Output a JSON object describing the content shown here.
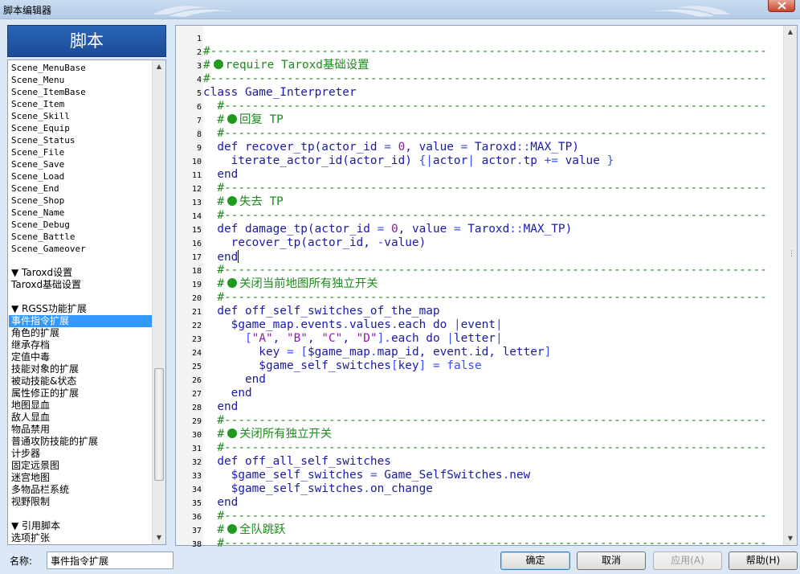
{
  "window": {
    "title": "脚本编辑器"
  },
  "left_panel": {
    "header": "脚本",
    "items": [
      {
        "label": "Scene_MenuBase",
        "mono": true
      },
      {
        "label": "Scene_Menu",
        "mono": true
      },
      {
        "label": "Scene_ItemBase",
        "mono": true
      },
      {
        "label": "Scene_Item",
        "mono": true
      },
      {
        "label": "Scene_Skill",
        "mono": true
      },
      {
        "label": "Scene_Equip",
        "mono": true
      },
      {
        "label": "Scene_Status",
        "mono": true
      },
      {
        "label": "Scene_File",
        "mono": true
      },
      {
        "label": "Scene_Save",
        "mono": true
      },
      {
        "label": "Scene_Load",
        "mono": true
      },
      {
        "label": "Scene_End",
        "mono": true
      },
      {
        "label": "Scene_Shop",
        "mono": true
      },
      {
        "label": "Scene_Name",
        "mono": true
      },
      {
        "label": "Scene_Debug",
        "mono": true
      },
      {
        "label": "Scene_Battle",
        "mono": true
      },
      {
        "label": "Scene_Gameover",
        "mono": true
      },
      {
        "label": ""
      },
      {
        "label": "▼ Taroxd设置"
      },
      {
        "label": "Taroxd基础设置"
      },
      {
        "label": ""
      },
      {
        "label": "▼ RGSS功能扩展"
      },
      {
        "label": "事件指令扩展",
        "selected": true
      },
      {
        "label": "角色的扩展"
      },
      {
        "label": "继承存档"
      },
      {
        "label": "定值中毒"
      },
      {
        "label": "技能对象的扩展"
      },
      {
        "label": "被动技能&状态"
      },
      {
        "label": "属性修正的扩展"
      },
      {
        "label": "地图显血"
      },
      {
        "label": "敌人显血"
      },
      {
        "label": "物品禁用"
      },
      {
        "label": "普通攻防技能的扩展"
      },
      {
        "label": "计步器"
      },
      {
        "label": "固定远景图"
      },
      {
        "label": "迷宫地图"
      },
      {
        "label": "多物品栏系统"
      },
      {
        "label": "视野限制"
      },
      {
        "label": ""
      },
      {
        "label": "▼ 引用脚本"
      },
      {
        "label": "选项扩张"
      }
    ]
  },
  "editor": {
    "lines": [
      {
        "n": "1",
        "parts": []
      },
      {
        "n": "2",
        "parts": [
          {
            "c": "c",
            "t": "#--------------------------------------------------------------------------------"
          }
        ]
      },
      {
        "n": "3",
        "parts": [
          {
            "c": "c",
            "t": "#"
          },
          {
            "c": "bullet"
          },
          {
            "c": "c",
            "t": "require Taroxd基础设置"
          }
        ]
      },
      {
        "n": "4",
        "parts": [
          {
            "c": "c",
            "t": "#--------------------------------------------------------------------------------"
          }
        ]
      },
      {
        "n": "5",
        "parts": [
          {
            "t": "class Game_Interpreter"
          }
        ]
      },
      {
        "n": "6",
        "parts": [
          {
            "c": "c",
            "t": "  #------------------------------------------------------------------------------"
          }
        ]
      },
      {
        "n": "7",
        "parts": [
          {
            "c": "c",
            "t": "  #"
          },
          {
            "c": "bullet"
          },
          {
            "c": "c",
            "t": "回复 TP"
          }
        ]
      },
      {
        "n": "8",
        "parts": [
          {
            "c": "c",
            "t": "  #------------------------------------------------------------------------------"
          }
        ]
      },
      {
        "n": "9",
        "parts": [
          {
            "t": "  def recover_tp(actor_id "
          },
          {
            "c": "o",
            "t": "="
          },
          {
            "t": " "
          },
          {
            "c": "n",
            "t": "0"
          },
          {
            "t": ", value "
          },
          {
            "c": "o",
            "t": "="
          },
          {
            "t": " Taroxd"
          },
          {
            "c": "o",
            "t": "::"
          },
          {
            "t": "MAX_TP)"
          }
        ]
      },
      {
        "n": "10",
        "parts": [
          {
            "t": "    iterate_actor_id(actor_id) "
          },
          {
            "c": "o",
            "t": "{|"
          },
          {
            "t": "actor"
          },
          {
            "c": "o",
            "t": "|"
          },
          {
            "t": " actor"
          },
          {
            "c": "o",
            "t": "."
          },
          {
            "t": "tp "
          },
          {
            "c": "o",
            "t": "+="
          },
          {
            "t": " value "
          },
          {
            "c": "o",
            "t": "}"
          }
        ]
      },
      {
        "n": "11",
        "parts": [
          {
            "t": "  end"
          }
        ]
      },
      {
        "n": "12",
        "parts": [
          {
            "c": "c",
            "t": "  #------------------------------------------------------------------------------"
          }
        ]
      },
      {
        "n": "13",
        "parts": [
          {
            "c": "c",
            "t": "  #"
          },
          {
            "c": "bullet"
          },
          {
            "c": "c",
            "t": "失去 TP"
          }
        ]
      },
      {
        "n": "14",
        "parts": [
          {
            "c": "c",
            "t": "  #------------------------------------------------------------------------------"
          }
        ]
      },
      {
        "n": "15",
        "parts": [
          {
            "t": "  def damage_tp(actor_id "
          },
          {
            "c": "o",
            "t": "="
          },
          {
            "t": " "
          },
          {
            "c": "n",
            "t": "0"
          },
          {
            "t": ", value "
          },
          {
            "c": "o",
            "t": "="
          },
          {
            "t": " Taroxd"
          },
          {
            "c": "o",
            "t": "::"
          },
          {
            "t": "MAX_TP)"
          }
        ]
      },
      {
        "n": "16",
        "parts": [
          {
            "t": "    recover_tp(actor_id, "
          },
          {
            "c": "o",
            "t": "-"
          },
          {
            "t": "value)"
          }
        ]
      },
      {
        "n": "17",
        "parts": [
          {
            "t": "  end"
          },
          {
            "c": "caret"
          }
        ]
      },
      {
        "n": "18",
        "parts": [
          {
            "c": "c",
            "t": "  #------------------------------------------------------------------------------"
          }
        ]
      },
      {
        "n": "19",
        "parts": [
          {
            "c": "c",
            "t": "  #"
          },
          {
            "c": "bullet"
          },
          {
            "c": "c",
            "t": "关闭当前地图所有独立开关"
          }
        ]
      },
      {
        "n": "20",
        "parts": [
          {
            "c": "c",
            "t": "  #------------------------------------------------------------------------------"
          }
        ]
      },
      {
        "n": "21",
        "parts": [
          {
            "t": "  def off_self_switches_of_the_map"
          }
        ]
      },
      {
        "n": "22",
        "parts": [
          {
            "t": "    $game_map"
          },
          {
            "c": "o",
            "t": "."
          },
          {
            "t": "events"
          },
          {
            "c": "o",
            "t": "."
          },
          {
            "t": "values"
          },
          {
            "c": "o",
            "t": "."
          },
          {
            "t": "each "
          },
          {
            "t": "do "
          },
          {
            "c": "o",
            "t": "|"
          },
          {
            "t": "event"
          },
          {
            "c": "o",
            "t": "|"
          }
        ]
      },
      {
        "n": "23",
        "parts": [
          {
            "t": "      "
          },
          {
            "c": "o",
            "t": "["
          },
          {
            "c": "s",
            "t": "\"A\""
          },
          {
            "t": ", "
          },
          {
            "c": "s",
            "t": "\"B\""
          },
          {
            "t": ", "
          },
          {
            "c": "s",
            "t": "\"C\""
          },
          {
            "t": ", "
          },
          {
            "c": "s",
            "t": "\"D\""
          },
          {
            "c": "o",
            "t": "]."
          },
          {
            "t": "each do "
          },
          {
            "c": "o",
            "t": "|"
          },
          {
            "t": "letter"
          },
          {
            "c": "o",
            "t": "|"
          }
        ]
      },
      {
        "n": "24",
        "parts": [
          {
            "t": "        key "
          },
          {
            "c": "o",
            "t": "="
          },
          {
            "t": " "
          },
          {
            "c": "o",
            "t": "["
          },
          {
            "t": "$game_map"
          },
          {
            "c": "o",
            "t": "."
          },
          {
            "t": "map_id, event"
          },
          {
            "c": "o",
            "t": "."
          },
          {
            "t": "id, letter"
          },
          {
            "c": "o",
            "t": "]"
          }
        ]
      },
      {
        "n": "25",
        "parts": [
          {
            "t": "        $game_self_switches"
          },
          {
            "c": "o",
            "t": "["
          },
          {
            "t": "key"
          },
          {
            "c": "o",
            "t": "]"
          },
          {
            "t": " "
          },
          {
            "c": "o",
            "t": "="
          },
          {
            "t": " "
          },
          {
            "c": "o",
            "t": "false"
          }
        ]
      },
      {
        "n": "26",
        "parts": [
          {
            "t": "      end"
          }
        ]
      },
      {
        "n": "27",
        "parts": [
          {
            "t": "    end"
          }
        ]
      },
      {
        "n": "28",
        "parts": [
          {
            "t": "  end"
          }
        ]
      },
      {
        "n": "29",
        "parts": [
          {
            "c": "c",
            "t": "  #------------------------------------------------------------------------------"
          }
        ]
      },
      {
        "n": "30",
        "parts": [
          {
            "c": "c",
            "t": "  #"
          },
          {
            "c": "bullet"
          },
          {
            "c": "c",
            "t": "关闭所有独立开关"
          }
        ]
      },
      {
        "n": "31",
        "parts": [
          {
            "c": "c",
            "t": "  #------------------------------------------------------------------------------"
          }
        ]
      },
      {
        "n": "32",
        "parts": [
          {
            "t": "  def off_all_self_switches"
          }
        ]
      },
      {
        "n": "33",
        "parts": [
          {
            "t": "    $game_self_switches "
          },
          {
            "c": "o",
            "t": "="
          },
          {
            "t": " Game_SelfSwitches"
          },
          {
            "c": "o",
            "t": "."
          },
          {
            "t": "new"
          }
        ]
      },
      {
        "n": "34",
        "parts": [
          {
            "t": "    $game_self_switches"
          },
          {
            "c": "o",
            "t": "."
          },
          {
            "t": "on_change"
          }
        ]
      },
      {
        "n": "35",
        "parts": [
          {
            "t": "  end"
          }
        ]
      },
      {
        "n": "36",
        "parts": [
          {
            "c": "c",
            "t": "  #------------------------------------------------------------------------------"
          }
        ]
      },
      {
        "n": "37",
        "parts": [
          {
            "c": "c",
            "t": "  #"
          },
          {
            "c": "bullet"
          },
          {
            "c": "c",
            "t": "全队跳跃"
          }
        ]
      },
      {
        "n": "38",
        "parts": [
          {
            "c": "c",
            "t": "  #------------------------------------------------------------------------------"
          }
        ]
      }
    ]
  },
  "footer": {
    "name_label": "名称:",
    "name_value": "事件指令扩展",
    "ok": "确定",
    "cancel": "取消",
    "apply": "应用(A)",
    "help": "帮助(H)"
  }
}
